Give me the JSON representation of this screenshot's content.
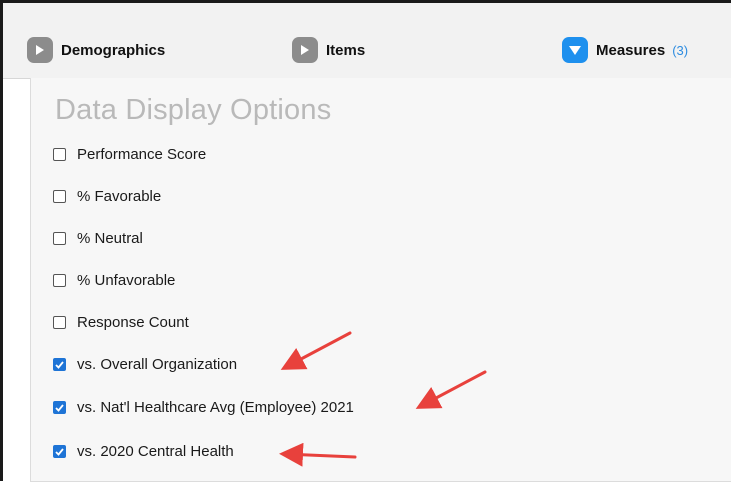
{
  "tabs": [
    {
      "label": "Demographics",
      "icon": "play-right-icon",
      "active": false
    },
    {
      "label": "Items",
      "icon": "play-right-icon",
      "active": false
    },
    {
      "label": "Measures",
      "icon": "triangle-down-icon",
      "active": true,
      "count": "(3)"
    }
  ],
  "panel": {
    "title": "Data Display Options",
    "options": [
      {
        "label": "Performance Score",
        "checked": false
      },
      {
        "label": "% Favorable",
        "checked": false
      },
      {
        "label": "% Neutral",
        "checked": false
      },
      {
        "label": "% Unfavorable",
        "checked": false
      },
      {
        "label": "Response Count",
        "checked": false
      },
      {
        "label": "vs. Overall Organization",
        "checked": true
      },
      {
        "label": "vs. Nat'l Healthcare Avg (Employee) 2021",
        "checked": true
      },
      {
        "label": "vs. 2020 Central Health",
        "checked": true
      }
    ]
  },
  "colors": {
    "active_tab_icon": "#1e90ee",
    "inactive_tab_icon": "#8c8c8c",
    "checkbox_checked": "#1e74d6",
    "annotation_arrow": "#e8413c",
    "title_text": "#b9b9b9"
  }
}
